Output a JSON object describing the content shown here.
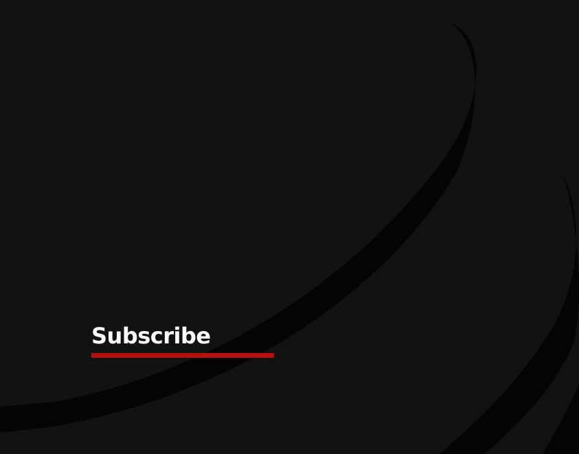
{
  "background_color": "#121212",
  "decoration_color": "#040404",
  "accent_color": "#b80f0f",
  "subscribe": {
    "label": "Subscribe"
  }
}
